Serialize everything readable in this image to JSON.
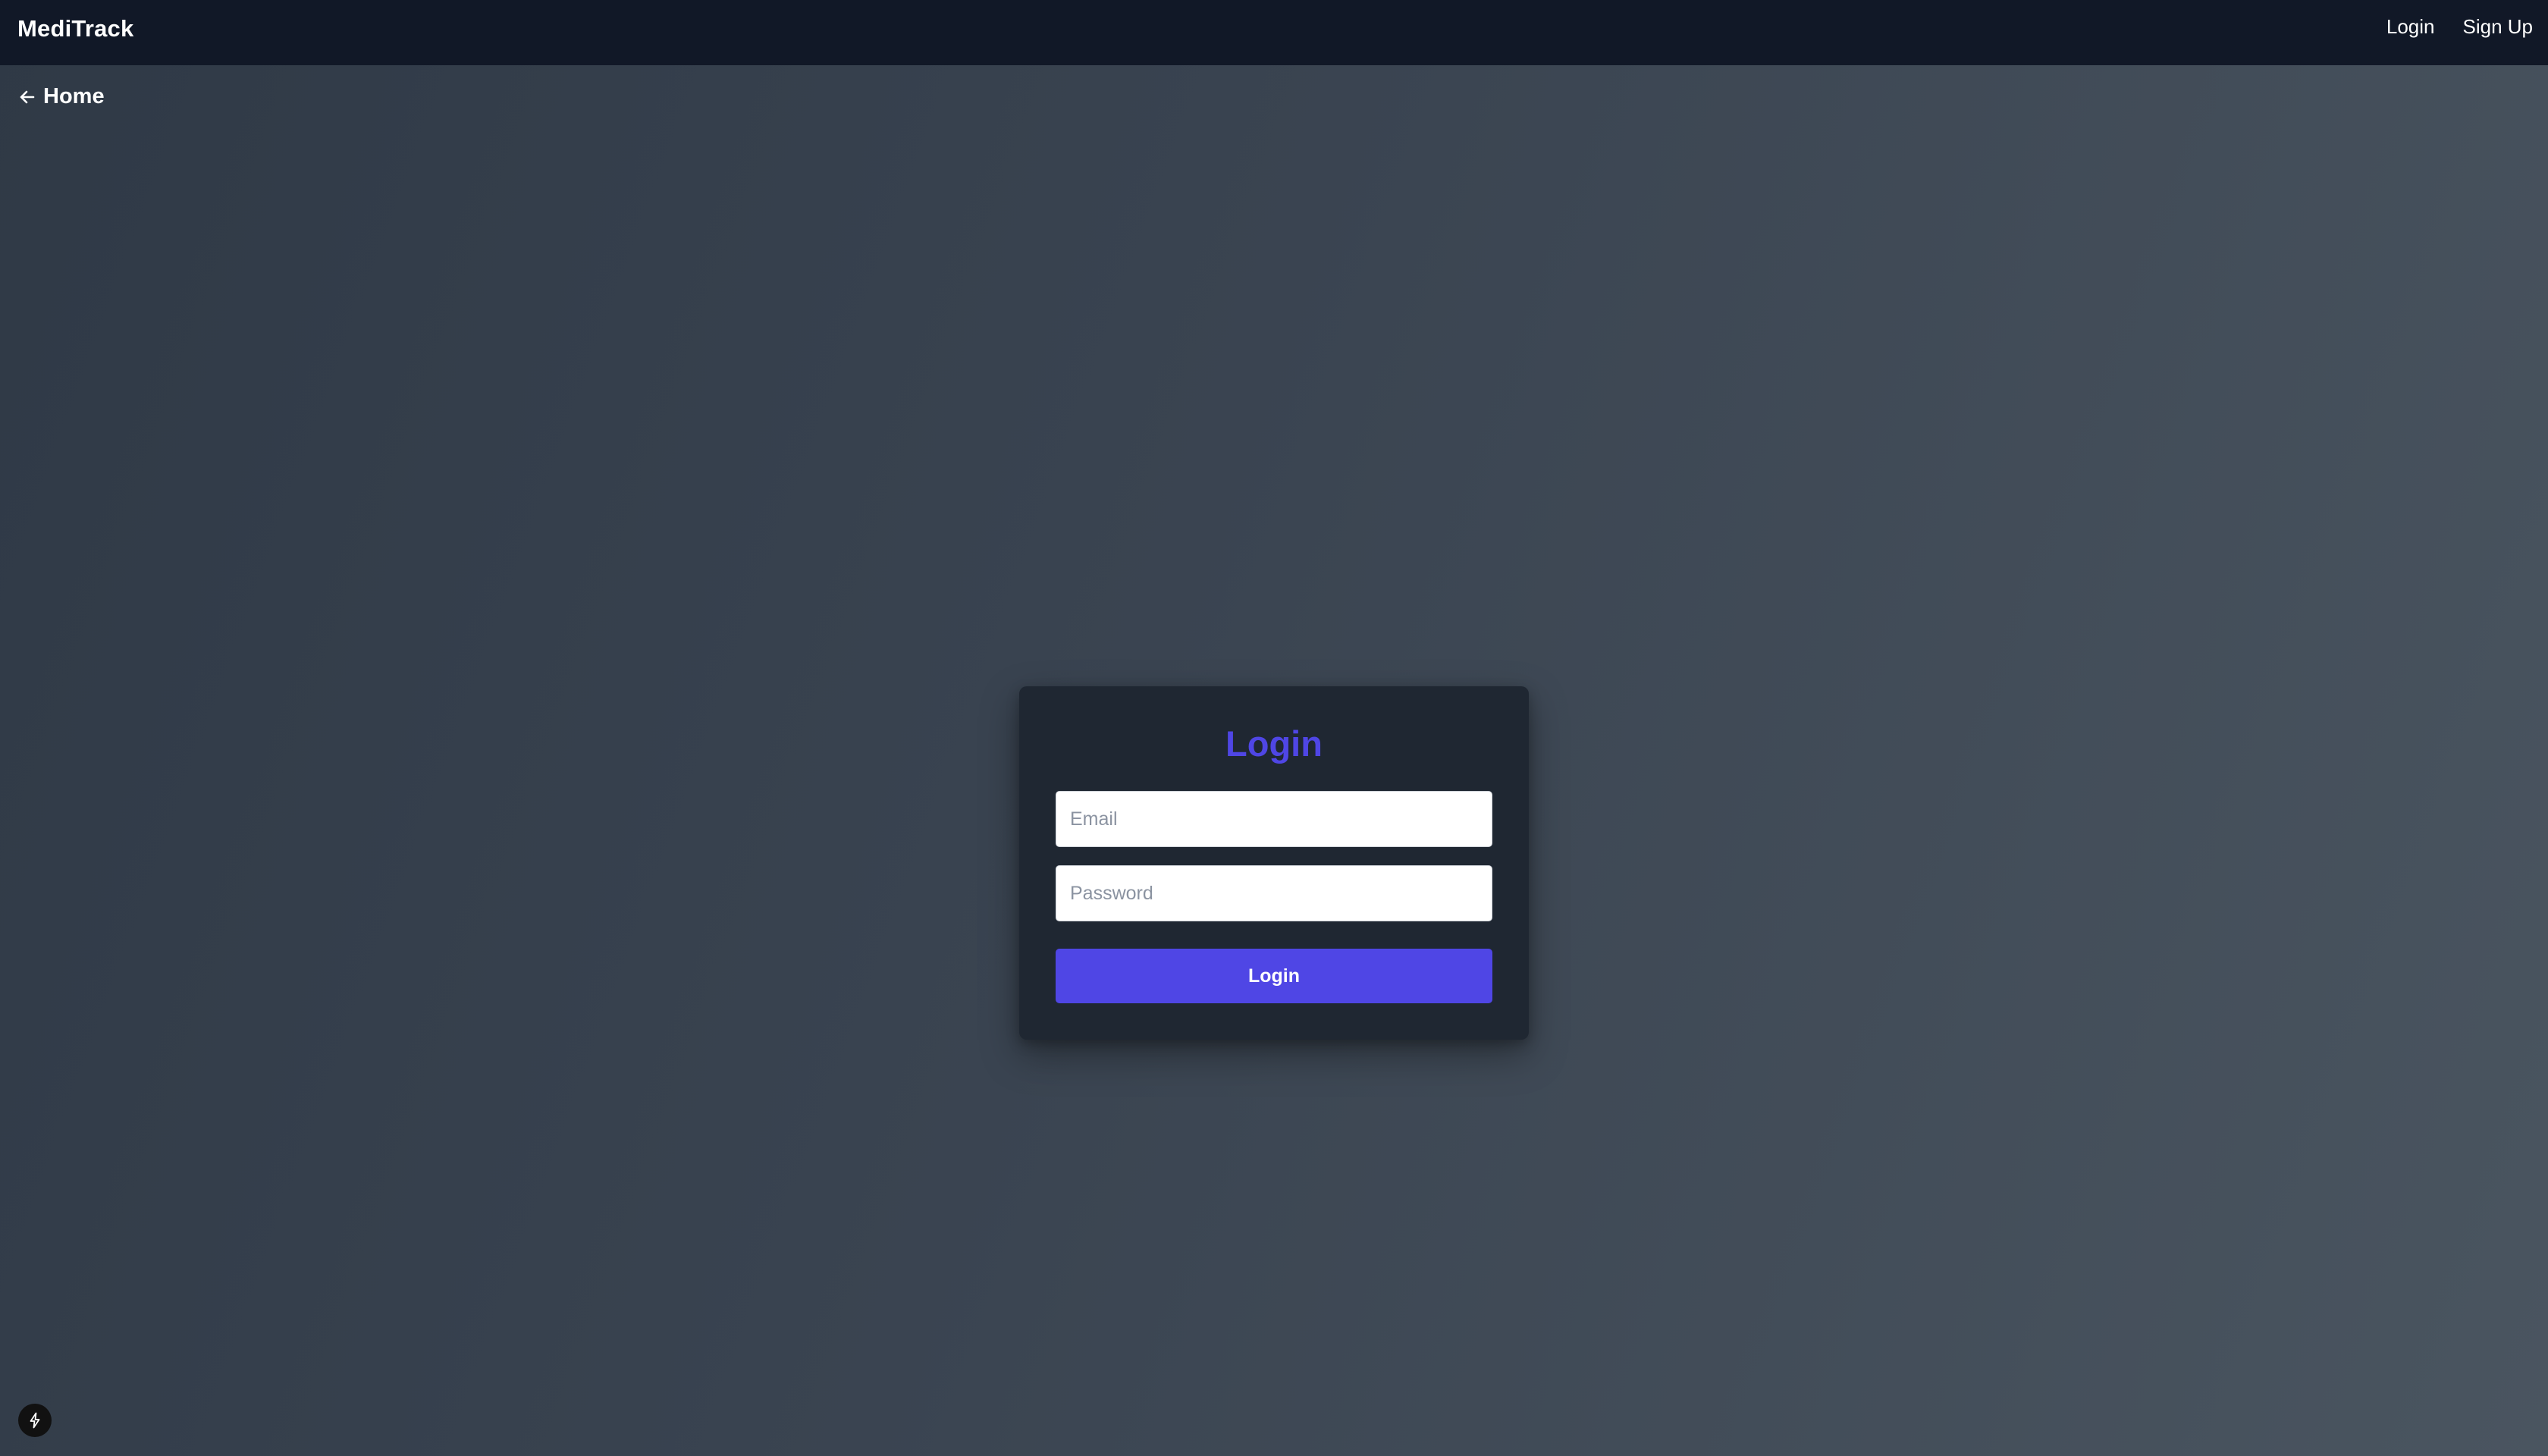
{
  "header": {
    "brand": "MediTrack",
    "nav": [
      {
        "label": "Login"
      },
      {
        "label": "Sign Up"
      }
    ]
  },
  "back_link": {
    "label": "Home",
    "icon": "arrow-left-icon"
  },
  "login_card": {
    "title": "Login",
    "email_placeholder": "Email",
    "email_value": "",
    "password_placeholder": "Password",
    "password_value": "",
    "submit_label": "Login",
    "accent_color": "#4f46e5"
  },
  "badge": {
    "icon": "lightning-bolt-icon"
  }
}
